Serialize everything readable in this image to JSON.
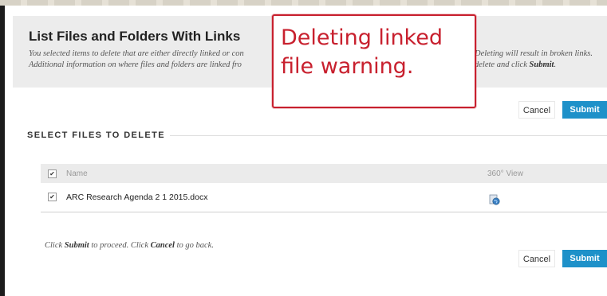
{
  "page": {
    "title": "List Files and Folders With Links",
    "instructions": {
      "line1_left": "You selected items to delete that are either directly linked or con",
      "line1_right": "Deleting will result in broken links.",
      "line2_left": "Additional information on where files and folders are linked fro",
      "line2_right_pre": "delete and click ",
      "line2_right_strong": "Submit",
      "line2_right_post": "."
    }
  },
  "callout": {
    "text": "Deleting linked file warning."
  },
  "buttons": {
    "cancel": "Cancel",
    "submit": "Submit"
  },
  "section": {
    "heading": "SELECT FILES TO DELETE"
  },
  "table": {
    "columns": [
      "Name",
      "360° View"
    ],
    "rows": [
      {
        "checked": true,
        "name": "ARC Research Agenda 2 1 2015.docx",
        "view_icon": "document-globe-icon"
      }
    ]
  },
  "footer": {
    "prefix": "Click ",
    "submit_word": "Submit",
    "middle": " to proceed. Click ",
    "cancel_word": "Cancel",
    "suffix": " to go back."
  },
  "colors": {
    "accent": "#1e91c9",
    "callout": "#c8202e"
  }
}
